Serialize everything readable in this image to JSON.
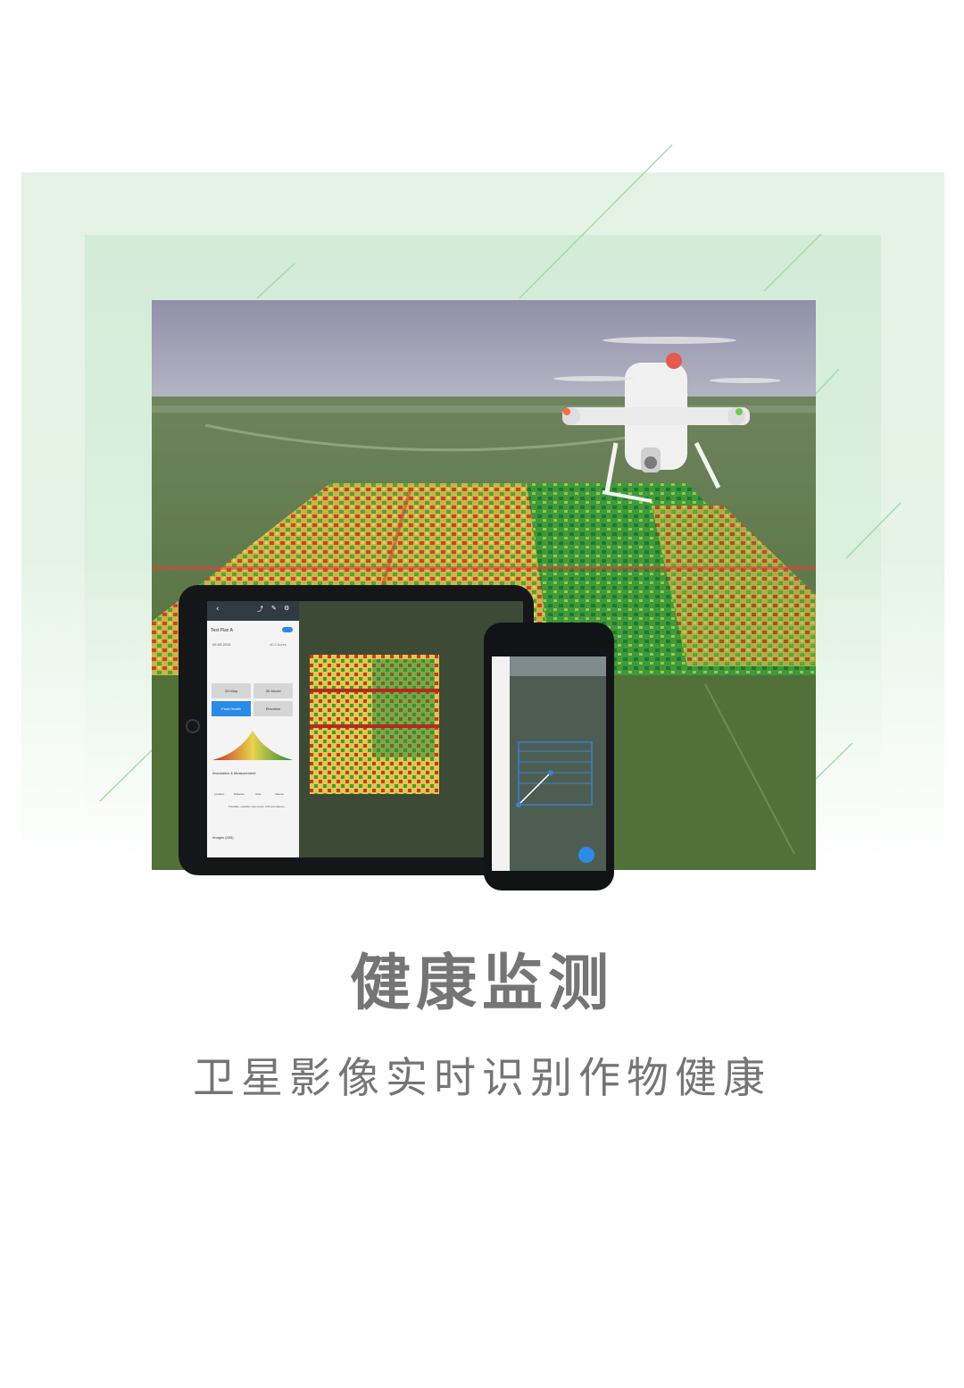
{
  "title": "健康监测",
  "subtitle": "卫星影像实时识别作物健康",
  "colors": {
    "outer_panel": "#e4f3e5",
    "inner_panel": "#d3ecd6",
    "accent_line": "#a7d7ad",
    "caption_text": "#757575"
  },
  "photo": {
    "description_icon": "drone-field-icon"
  },
  "tablet_app": {
    "plan_title": "Test Plan A",
    "date": "09-09-2016",
    "area": "40.2 Acres",
    "buttons": [
      "2D Map",
      "3D Model",
      "Plant Health",
      "Elevation"
    ],
    "section": "Annotation & Measurement",
    "tools": [
      "Location",
      "Distance",
      "Area",
      "Volume"
    ],
    "report_text": "Printable, editable map report, with annotations.",
    "images_label": "Images (335)"
  }
}
